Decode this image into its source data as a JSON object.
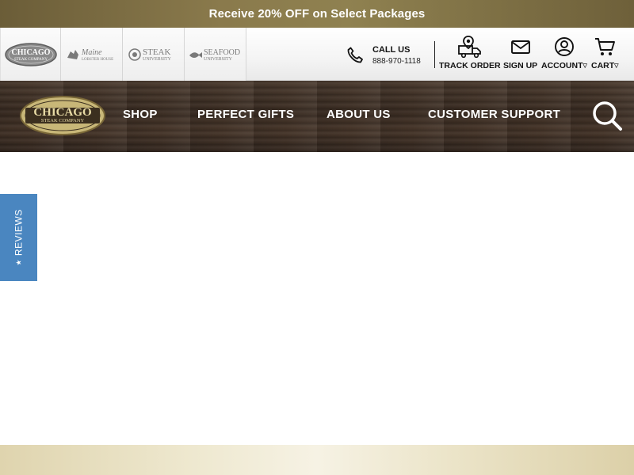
{
  "promo": {
    "text": "Receive 20% OFF on Select Packages"
  },
  "brands": [
    {
      "name": "chicago-steak-company",
      "line1": "CHICAGO",
      "line2": "STEAK COMPANY"
    },
    {
      "name": "maine-lobster-house",
      "line1": "Maine",
      "line2": "LOBSTER HOUSE"
    },
    {
      "name": "steak-university",
      "line1": "STEAK",
      "line2": "UNIVERSITY"
    },
    {
      "name": "seafood-university",
      "line1": "SEAFOOD",
      "line2": "UNIVERSITY"
    }
  ],
  "call": {
    "label": "CALL US",
    "number": "888-970-1118",
    "icon": "phone-icon"
  },
  "utility": {
    "track_order": "TRACK ORDER",
    "sign_up": "SIGN UP",
    "account": "ACCOUNT",
    "cart": "CART",
    "caret": "▽"
  },
  "nav": {
    "logo_line1": "CHICAGO",
    "logo_line2": "STEAK COMPANY",
    "shop": "SHOP",
    "perfect_gifts": "PERFECT GIFTS",
    "about_us": "ABOUT US",
    "customer_support": "CUSTOMER SUPPORT"
  },
  "reviews": {
    "star": "★",
    "label": "REVIEWS"
  },
  "colors": {
    "promo_bg": "#7d6e45",
    "nav_wood": "#3f3026",
    "reviews_tab": "#4a86c0",
    "gold": "#b9a468"
  }
}
